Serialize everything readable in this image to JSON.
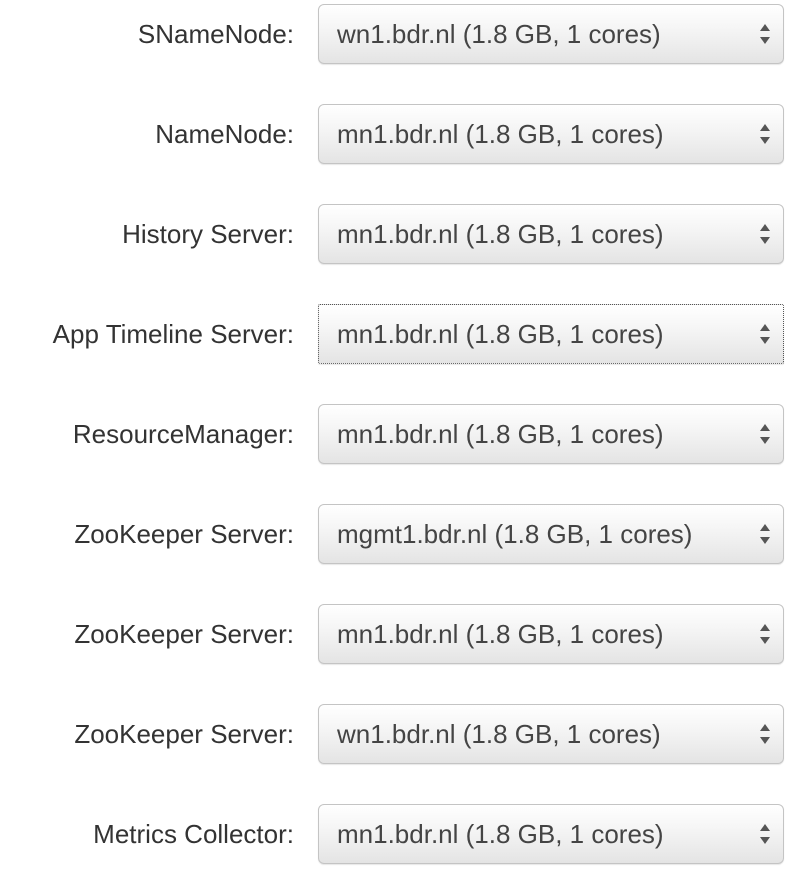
{
  "fields": [
    {
      "label": "SNameNode:",
      "value": "wn1.bdr.nl (1.8 GB, 1 cores)",
      "focused": false
    },
    {
      "label": "NameNode:",
      "value": "mn1.bdr.nl (1.8 GB, 1 cores)",
      "focused": false
    },
    {
      "label": "History Server:",
      "value": "mn1.bdr.nl (1.8 GB, 1 cores)",
      "focused": false
    },
    {
      "label": "App Timeline Server:",
      "value": "mn1.bdr.nl (1.8 GB, 1 cores)",
      "focused": true
    },
    {
      "label": "ResourceManager:",
      "value": "mn1.bdr.nl (1.8 GB, 1 cores)",
      "focused": false
    },
    {
      "label": "ZooKeeper Server:",
      "value": "mgmt1.bdr.nl (1.8 GB, 1 cores)",
      "focused": false
    },
    {
      "label": "ZooKeeper Server:",
      "value": "mn1.bdr.nl (1.8 GB, 1 cores)",
      "focused": false
    },
    {
      "label": "ZooKeeper Server:",
      "value": "wn1.bdr.nl (1.8 GB, 1 cores)",
      "focused": false
    },
    {
      "label": "Metrics Collector:",
      "value": "mn1.bdr.nl (1.8 GB, 1 cores)",
      "focused": false
    }
  ]
}
